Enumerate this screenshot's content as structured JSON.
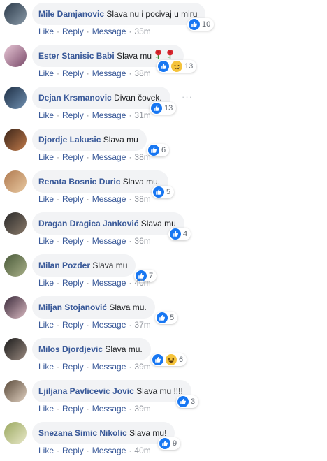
{
  "actions": {
    "like": "Like",
    "reply": "Reply",
    "message": "Message",
    "more": "···"
  },
  "icons": {
    "like": "like-reaction-icon",
    "sad": "sad-reaction-icon",
    "haha": "haha-reaction-icon",
    "rose": "rose-emoji-icon"
  },
  "colors": {
    "author": "#385898",
    "bubble": "#f2f3f5",
    "like_blue": "#1877f2",
    "meta_gray": "#90949c"
  },
  "comments": [
    {
      "author": "Mile Damjanovic",
      "text": "Slava nu i pocivaj u miru",
      "time": "35m",
      "reactions": [
        "like"
      ],
      "count": "10"
    },
    {
      "author": "Ester Stanisic Babi",
      "text": "Slava mu",
      "emoji": [
        "rose",
        "rose"
      ],
      "time": "38m",
      "reactions": [
        "like",
        "sad"
      ],
      "count": "13"
    },
    {
      "author": "Dejan Krsmanovic",
      "text": "Divan čovek.",
      "time": "31m",
      "reactions": [
        "like"
      ],
      "count": "13"
    },
    {
      "author": "Djordje Lakusic",
      "text": "Slava mu",
      "time": "38m",
      "reactions": [
        "like"
      ],
      "count": "6"
    },
    {
      "author": "Renata Bosnic Duric",
      "text": "Slava mu.",
      "time": "38m",
      "reactions": [
        "like"
      ],
      "count": "5"
    },
    {
      "author": "Dragan Dragica Janković",
      "text": "Slava mu",
      "time": "36m",
      "reactions": [
        "like"
      ],
      "count": "4"
    },
    {
      "author": "Milan Pozder",
      "text": "Slava mu",
      "time": "40m",
      "reactions": [
        "like"
      ],
      "count": "7"
    },
    {
      "author": "Miljan Stojanović",
      "text": "Slava mu.",
      "time": "37m",
      "reactions": [
        "like"
      ],
      "count": "5"
    },
    {
      "author": "Milos Djordjevic",
      "text": "Slava mu.",
      "time": "39m",
      "reactions": [
        "like",
        "haha"
      ],
      "count": "6"
    },
    {
      "author": "Ljiljana Pavlicevic Jovic",
      "text": "Slava mu !!!!",
      "time": "39m",
      "reactions": [
        "like"
      ],
      "count": "3"
    },
    {
      "author": "Snezana Simic Nikolic",
      "text": "Slava mu!",
      "time": "40m",
      "reactions": [
        "like"
      ],
      "count": "9"
    }
  ]
}
